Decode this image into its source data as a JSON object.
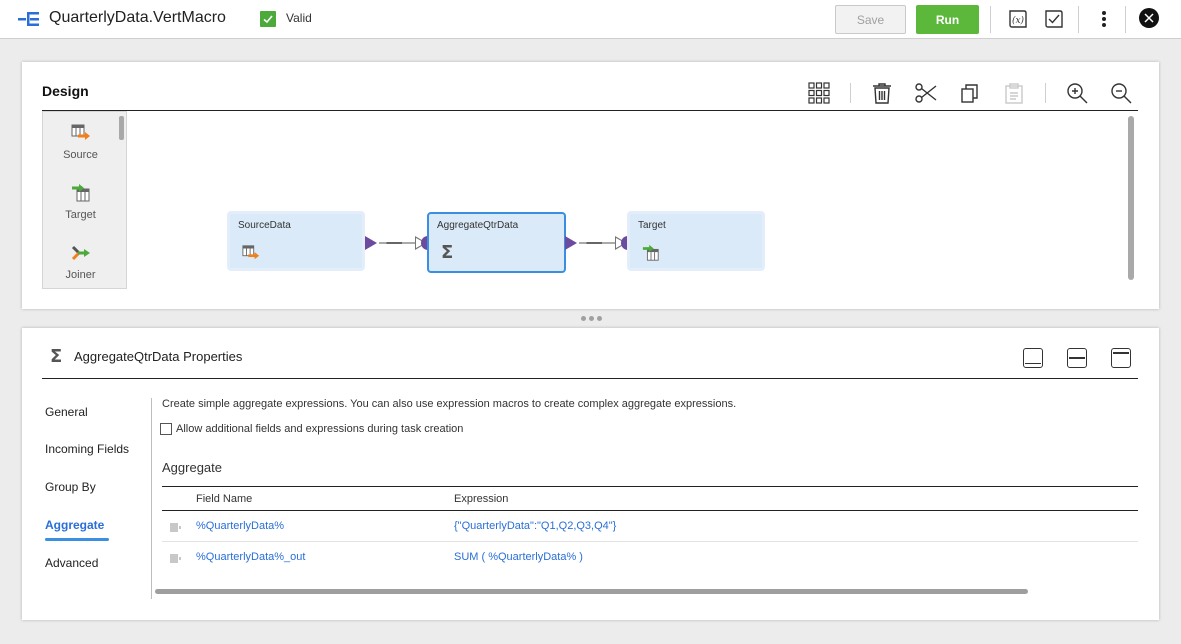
{
  "header": {
    "title": "QuarterlyData.VertMacro",
    "status": "Valid",
    "status_color": "#4caa3a",
    "save_label": "Save",
    "run_label": "Run",
    "run_color": "#5cb83a",
    "icons": [
      "mapping-icon",
      "validate-expression-icon",
      "validate-icon",
      "more-vertical-icon",
      "close-icon"
    ]
  },
  "design": {
    "title": "Design",
    "toolbar": [
      "grid-arrange-icon",
      "trash-icon",
      "cut-icon",
      "copy-icon",
      "paste-icon",
      "zoom-in-icon",
      "zoom-out-icon"
    ],
    "palette": [
      {
        "label": "Source",
        "icon": "source-icon"
      },
      {
        "label": "Target",
        "icon": "target-icon"
      },
      {
        "label": "Joiner",
        "icon": "joiner-icon"
      }
    ],
    "nodes": [
      {
        "label": "SourceData",
        "icon": "source-icon",
        "selected": false
      },
      {
        "label": "AggregateQtrData",
        "icon": "sigma-icon",
        "selected": true
      },
      {
        "label": "Target",
        "icon": "target-icon",
        "selected": false
      }
    ]
  },
  "properties": {
    "title": "AggregateQtrData Properties",
    "nav": [
      {
        "label": "General",
        "active": false
      },
      {
        "label": "Incoming Fields",
        "active": false
      },
      {
        "label": "Group By",
        "active": false
      },
      {
        "label": "Aggregate",
        "active": true
      },
      {
        "label": "Advanced",
        "active": false
      }
    ],
    "description": "Create simple aggregate expressions. You can also use expression macros to create complex aggregate expressions.",
    "checkbox_label": "Allow additional fields and expressions during task creation",
    "checkbox_checked": false,
    "section_title": "Aggregate",
    "table": {
      "headers": [
        "Field Name",
        "Expression"
      ],
      "rows": [
        {
          "field": "%QuarterlyData%",
          "expression": "{\"QuarterlyData\":\"Q1,Q2,Q3,Q4\"}"
        },
        {
          "field": "%QuarterlyData%_out",
          "expression": "SUM ( %QuarterlyData% )"
        }
      ]
    },
    "accent_color": "#2a6fd6"
  }
}
